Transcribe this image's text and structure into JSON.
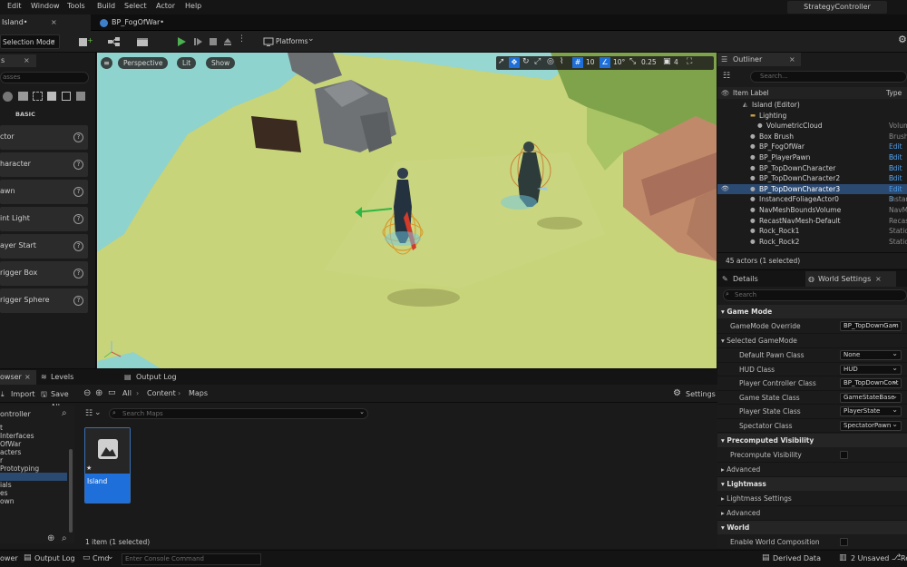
{
  "menu": {
    "items": [
      "Edit",
      "Window",
      "Tools",
      "Build",
      "Select",
      "Actor",
      "Help"
    ],
    "project_name": "StrategyController"
  },
  "tabs": {
    "level_tab": "Island•",
    "blueprint_tab": "BP_FogOfWar•"
  },
  "toolbar": {
    "mode_label": "Selection Mode",
    "platforms_label": "Platforms"
  },
  "place_actors": {
    "tab_label": "s",
    "search_placeholder": "asses",
    "category": "BASIC",
    "items": [
      "ctor",
      "haracter",
      "awn",
      "int Light",
      "ayer Start",
      "rigger Box",
      "rigger Sphere"
    ]
  },
  "viewport": {
    "perspective": "Perspective",
    "lit": "Lit",
    "show": "Show",
    "grid_snap": "10",
    "rot_snap": "10°",
    "scale_snap": "0.25",
    "cam_speed": "4"
  },
  "outliner": {
    "title": "Outliner",
    "search_placeholder": "Search...",
    "col_label": "Item Label",
    "col_type": "Type",
    "rows": [
      {
        "label": "Island (Editor)",
        "type": "",
        "indent": 1
      },
      {
        "label": "Lighting",
        "type": "",
        "indent": 2
      },
      {
        "label": "VolumetricCloud",
        "type": "Volum",
        "indent": 3
      },
      {
        "label": "Box Brush",
        "type": "Brush",
        "indent": 2
      },
      {
        "label": "BP_FogOfWar",
        "type": "Edit B",
        "indent": 2
      },
      {
        "label": "BP_PlayerPawn",
        "type": "Edit B",
        "indent": 2
      },
      {
        "label": "BP_TopDownCharacter",
        "type": "Edit B",
        "indent": 2
      },
      {
        "label": "BP_TopDownCharacter2",
        "type": "Edit B",
        "indent": 2
      },
      {
        "label": "BP_TopDownCharacter3",
        "type": "Edit B",
        "indent": 2
      },
      {
        "label": "InstancedFoliageActor0",
        "type": "Instan",
        "indent": 2
      },
      {
        "label": "NavMeshBoundsVolume",
        "type": "NavMe",
        "indent": 2
      },
      {
        "label": "RecastNavMesh-Default",
        "type": "Recas",
        "indent": 2
      },
      {
        "label": "Rock_Rock1",
        "type": "Static",
        "indent": 2
      },
      {
        "label": "Rock_Rock2",
        "type": "Static",
        "indent": 2
      }
    ],
    "footer": "45 actors (1 selected)"
  },
  "details": {
    "tab_details": "Details",
    "tab_world": "World Settings",
    "search_placeholder": "Search",
    "sec_game_mode": "Game Mode",
    "gm_override_label": "GameMode Override",
    "gm_override_value": "BP_TopDownGam",
    "selected_gm": "Selected GameMode",
    "props": [
      {
        "label": "Default Pawn Class",
        "value": "None"
      },
      {
        "label": "HUD Class",
        "value": "HUD"
      },
      {
        "label": "Player Controller Class",
        "value": "BP_TopDownCont"
      },
      {
        "label": "Game State Class",
        "value": "GameStateBase"
      },
      {
        "label": "Player State Class",
        "value": "PlayerState"
      },
      {
        "label": "Spectator Class",
        "value": "SpectatorPawn"
      }
    ],
    "sec_precomputed": "Precomputed Visibility",
    "precompute_label": "Precompute Visibility",
    "advanced": "Advanced",
    "sec_lightmass": "Lightmass",
    "lightmass_settings": "Lightmass Settings",
    "advanced2": "Advanced",
    "sec_world": "World",
    "enable_world_comp": "Enable World Composition"
  },
  "content_browser": {
    "tab_browser": "owser",
    "tab_levels": "Levels",
    "tab_output": "Output Log",
    "import": "Import",
    "save_all": "Save All",
    "crumbs": [
      "All",
      "Content",
      "Maps"
    ],
    "settings": "Settings",
    "search_placeholder": "Search Maps",
    "tree_header": "ontroller",
    "tree_items": [
      "t",
      "Interfaces",
      "OfWar",
      "acters",
      "r",
      "Prototyping",
      "",
      "ials",
      "es",
      "own"
    ],
    "asset_name": "Island",
    "footer": "1 item (1 selected)"
  },
  "statusbar": {
    "browser": "ower",
    "output_log": "Output Log",
    "cmd": "Cmd",
    "console_placeholder": "Enter Console Command",
    "derived": "Derived Data",
    "unsaved": "2 Unsaved",
    "revision": "Re"
  },
  "colors": {
    "accent_blue": "#1e6fd9",
    "selection": "#2b4a72",
    "play_green": "#4caf50"
  }
}
